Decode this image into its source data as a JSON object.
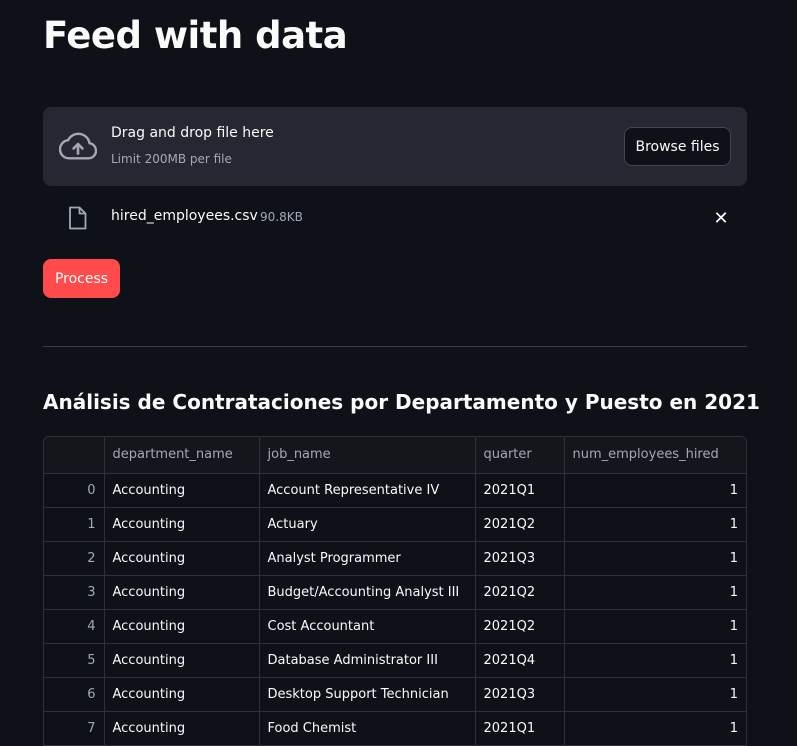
{
  "page": {
    "title": "Feed with data"
  },
  "uploader": {
    "drop_text": "Drag and drop file here",
    "limit_text": "Limit 200MB per file",
    "browse_label": "Browse files",
    "icon": "cloud-upload-icon"
  },
  "uploaded_file": {
    "name": "hired_employees.csv",
    "size": "90.8KB",
    "icon": "file-icon",
    "remove_icon": "close-icon",
    "remove_glyph": "✕"
  },
  "process_button": {
    "label": "Process"
  },
  "section": {
    "title": "Análisis de Contrataciones por Departamento y Puesto en 2021"
  },
  "table": {
    "columns": [
      "",
      "department_name",
      "job_name",
      "quarter",
      "num_employees_hired"
    ],
    "rows": [
      {
        "index": "0",
        "department_name": "Accounting",
        "job_name": "Account Representative IV",
        "quarter": "2021Q1",
        "num_employees_hired": "1"
      },
      {
        "index": "1",
        "department_name": "Accounting",
        "job_name": "Actuary",
        "quarter": "2021Q2",
        "num_employees_hired": "1"
      },
      {
        "index": "2",
        "department_name": "Accounting",
        "job_name": "Analyst Programmer",
        "quarter": "2021Q3",
        "num_employees_hired": "1"
      },
      {
        "index": "3",
        "department_name": "Accounting",
        "job_name": "Budget/Accounting Analyst III",
        "quarter": "2021Q2",
        "num_employees_hired": "1"
      },
      {
        "index": "4",
        "department_name": "Accounting",
        "job_name": "Cost Accountant",
        "quarter": "2021Q2",
        "num_employees_hired": "1"
      },
      {
        "index": "5",
        "department_name": "Accounting",
        "job_name": "Database Administrator III",
        "quarter": "2021Q4",
        "num_employees_hired": "1"
      },
      {
        "index": "6",
        "department_name": "Accounting",
        "job_name": "Desktop Support Technician",
        "quarter": "2021Q3",
        "num_employees_hired": "1"
      },
      {
        "index": "7",
        "department_name": "Accounting",
        "job_name": "Food Chemist",
        "quarter": "2021Q1",
        "num_employees_hired": "1"
      }
    ]
  },
  "colors": {
    "background": "#0e1117",
    "surface": "#262730",
    "primary": "#ff4b4b",
    "text": "#fafafa",
    "muted_text": "#a3a8b8",
    "border": "#2f3038"
  }
}
